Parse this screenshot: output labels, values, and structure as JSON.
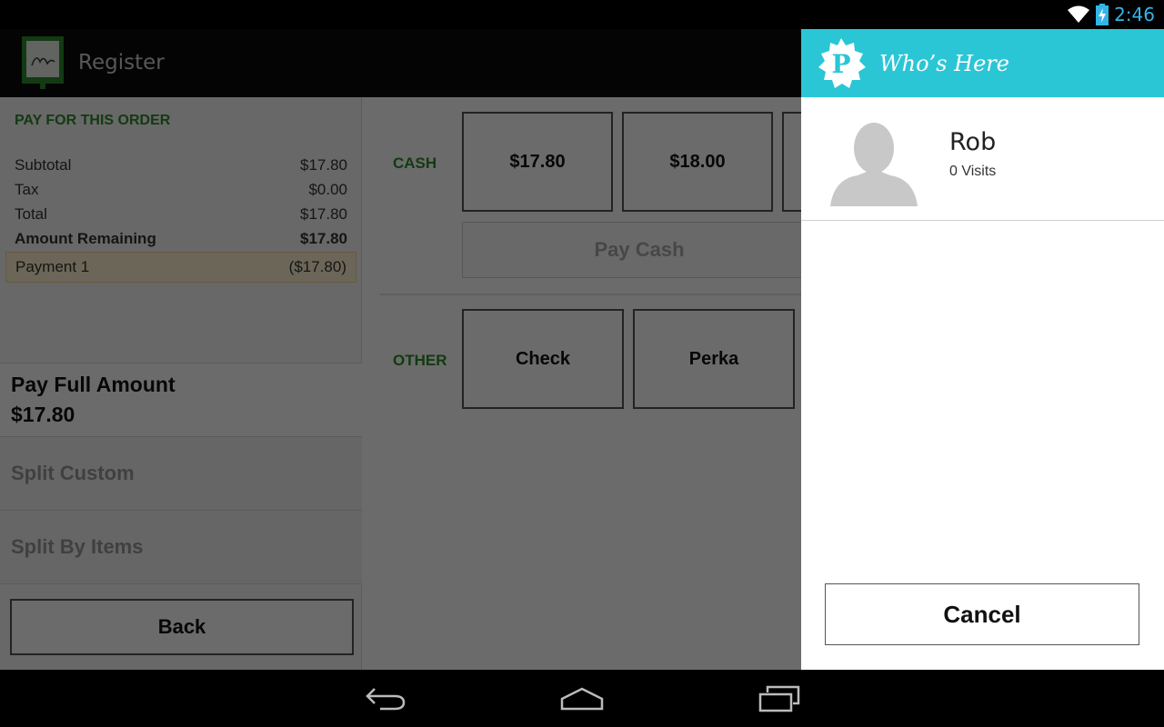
{
  "status_bar": {
    "time": "2:46",
    "icons": [
      "wifi-icon",
      "battery-charging-icon"
    ]
  },
  "app": {
    "title": "Register",
    "logo_icon": "register-logo-icon"
  },
  "order": {
    "section_title": "PAY FOR THIS ORDER",
    "lines": [
      {
        "label": "Subtotal",
        "value": "$17.80"
      },
      {
        "label": "Tax",
        "value": "$0.00"
      },
      {
        "label": "Total",
        "value": "$17.80"
      },
      {
        "label": "Amount Remaining",
        "value": "$17.80"
      }
    ],
    "payment": {
      "label": "Payment 1",
      "value": "($17.80)"
    }
  },
  "options": {
    "full_label": "Pay Full Amount",
    "full_amount": "$17.80",
    "split_custom": "Split Custom",
    "split_items": "Split By Items",
    "back": "Back"
  },
  "cash": {
    "label": "CASH",
    "amounts": [
      "$17.80",
      "$18.00"
    ],
    "pay_cash": "Pay Cash"
  },
  "other": {
    "label": "OTHER",
    "methods": [
      "Check",
      "Perka"
    ]
  },
  "whos_here": {
    "title": "Who’s Here",
    "logo_letter": "P",
    "person": {
      "name": "Rob",
      "visits": "0 Visits"
    },
    "cancel": "Cancel"
  },
  "colors": {
    "accent": "#2ac6d6",
    "green": "#2e8b2e",
    "status_blue": "#33b5e5"
  },
  "nav": {
    "icons": [
      "back-icon",
      "home-icon",
      "recent-apps-icon"
    ]
  }
}
